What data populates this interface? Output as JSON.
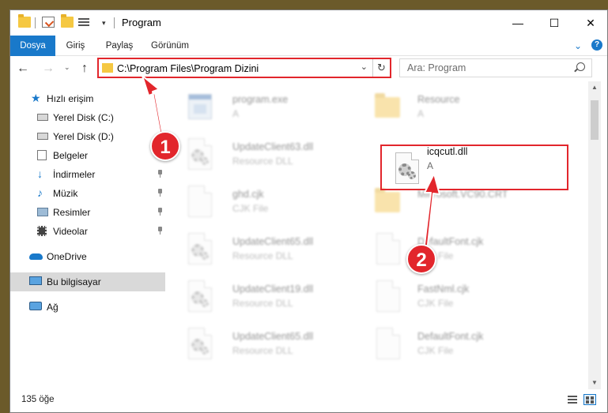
{
  "window": {
    "title": "Program"
  },
  "ribbon": {
    "tabs": [
      "Dosya",
      "Giriş",
      "Paylaş",
      "Görünüm"
    ]
  },
  "address": {
    "path": "C:\\Program Files\\Program Dizini"
  },
  "search": {
    "placeholder": "Ara: Program"
  },
  "sidebar": {
    "items": [
      {
        "label": "Hızlı erişim",
        "icon": "star-icon"
      },
      {
        "label": "Yerel Disk (C:)",
        "icon": "drive-icon"
      },
      {
        "label": "Yerel Disk (D:)",
        "icon": "drive-icon"
      },
      {
        "label": "Belgeler",
        "icon": "documents-icon"
      },
      {
        "label": "İndirmeler",
        "icon": "download-icon"
      },
      {
        "label": "Müzik",
        "icon": "music-icon"
      },
      {
        "label": "Resimler",
        "icon": "pictures-icon"
      },
      {
        "label": "Videolar",
        "icon": "video-icon"
      },
      {
        "label": "OneDrive",
        "icon": "cloud-icon"
      },
      {
        "label": "Bu bilgisayar",
        "icon": "computer-icon"
      },
      {
        "label": "Ağ",
        "icon": "network-icon"
      }
    ]
  },
  "files": [
    {
      "name": "program.exe",
      "type": "A",
      "icon": "exe-icon"
    },
    {
      "name": "Resource",
      "type": "A",
      "icon": "folder-icon"
    },
    {
      "name": "UpdateClient63.dll",
      "type": "Resource DLL",
      "icon": "dll-icon"
    },
    {
      "name": "icqcutl.dll",
      "type": "A",
      "icon": "dll-icon"
    },
    {
      "name": "ghd.cjk",
      "type": "CJK File",
      "icon": "file-icon"
    },
    {
      "name": "Microsoft.VC90.CRT",
      "type": "",
      "icon": "folder-icon"
    },
    {
      "name": "UpdateClient65.dll",
      "type": "Resource DLL",
      "icon": "dll-icon"
    },
    {
      "name": "DefaultFont.cjk",
      "type": "CJK File",
      "icon": "file-icon"
    },
    {
      "name": "UpdateClient19.dll",
      "type": "Resource DLL",
      "icon": "dll-icon"
    },
    {
      "name": "FastNml.cjk",
      "type": "CJK File",
      "icon": "file-icon"
    },
    {
      "name": "UpdateClient65.dll",
      "type": "Resource DLL",
      "icon": "dll-icon"
    },
    {
      "name": "DefaultFont.cjk",
      "type": "CJK File",
      "icon": "file-icon"
    }
  ],
  "status": {
    "item_count": "135 öğe"
  },
  "annotations": {
    "badge1": "1",
    "badge2": "2"
  },
  "colors": {
    "accent": "#1979ca",
    "highlight": "#e2262c"
  }
}
